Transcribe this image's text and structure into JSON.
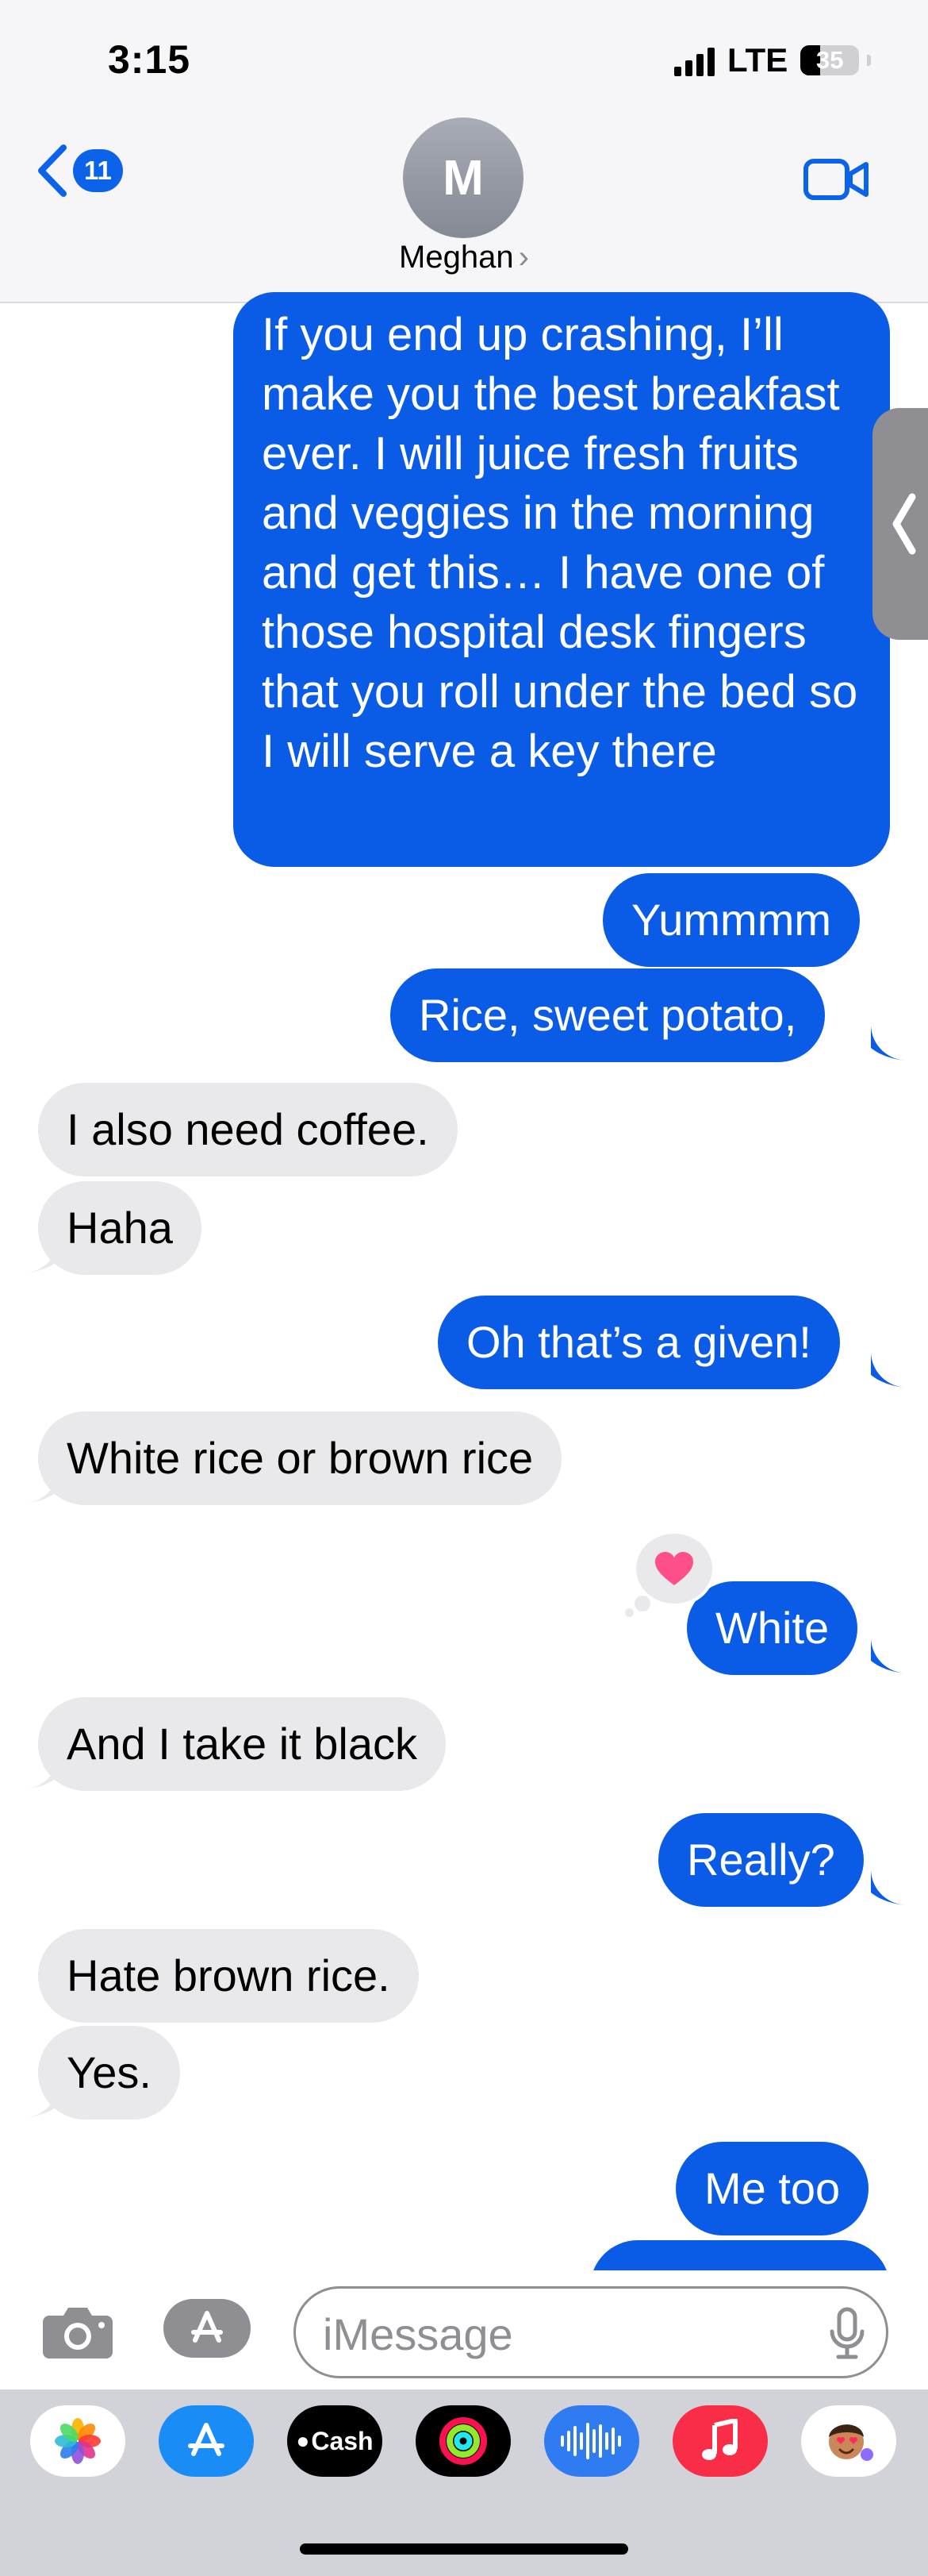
{
  "status_bar": {
    "time": "3:15",
    "network": "LTE",
    "battery": "35"
  },
  "header": {
    "back_badge": "11",
    "contact_initial": "M",
    "contact_name": "Meghan",
    "contact_chevron": "›"
  },
  "messages": [
    {
      "direction": "outgoing",
      "text": "If you end up crashing, I’ll make you the best breakfast ever. I will juice fresh fruits and veggies in the morning and get this… I have one of those hospital desk fingers that you roll under the bed so I will serve a key there"
    },
    {
      "direction": "outgoing",
      "text": "Yummmm"
    },
    {
      "direction": "outgoing",
      "text": "Rice, sweet potato,"
    },
    {
      "direction": "incoming",
      "text": "I also need coffee."
    },
    {
      "direction": "incoming",
      "text": "Haha"
    },
    {
      "direction": "outgoing",
      "text": "Oh that’s a given!"
    },
    {
      "direction": "incoming",
      "text": "White rice or brown rice"
    },
    {
      "direction": "outgoing",
      "text": "White",
      "reaction": "heart-icon"
    },
    {
      "direction": "incoming",
      "text": "And I take it black"
    },
    {
      "direction": "outgoing",
      "text": "Really?"
    },
    {
      "direction": "incoming",
      "text": "Hate brown rice."
    },
    {
      "direction": "incoming",
      "text": "Yes."
    },
    {
      "direction": "outgoing",
      "text": "Me too"
    }
  ],
  "input": {
    "placeholder": "iMessage"
  },
  "app_drawer": [
    {
      "name": "photos-app-icon"
    },
    {
      "name": "app-store-icon"
    },
    {
      "name": "apple-cash-icon",
      "label": "Cash"
    },
    {
      "name": "activity-rings-icon"
    },
    {
      "name": "audio-message-icon"
    },
    {
      "name": "music-app-icon"
    },
    {
      "name": "memoji-icon"
    }
  ],
  "colors": {
    "outgoing_bubble": "#0a5ce6",
    "incoming_bubble": "#e9e9eb",
    "accent": "#0a63e8",
    "reaction_heart": "#ff4f8a"
  }
}
